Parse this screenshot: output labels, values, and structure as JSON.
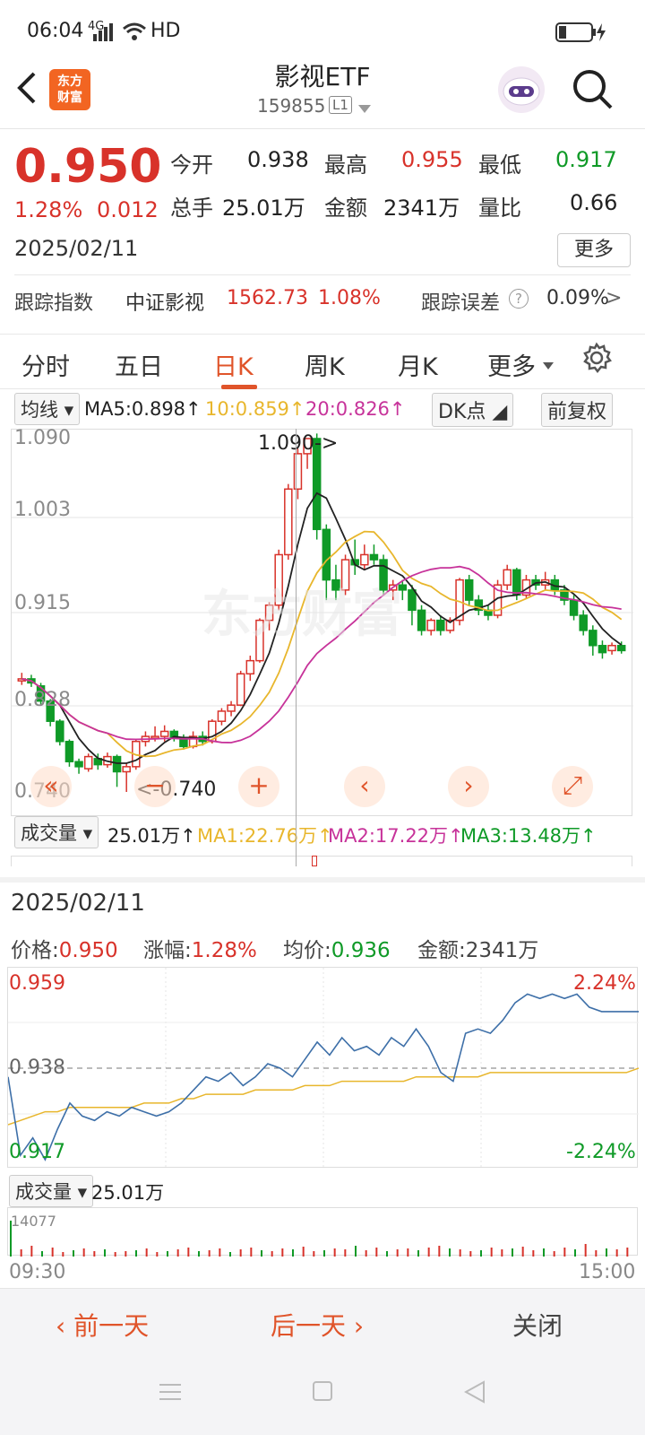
{
  "status": {
    "time": "06:04",
    "signal": "4G",
    "network": "HD"
  },
  "header": {
    "title": "影视ETF",
    "code": "159855",
    "level": "L1",
    "logo_text_1": "东方",
    "logo_text_2": "财富"
  },
  "quote": {
    "price": "0.950",
    "change_pct": "1.28%",
    "change_amt": "0.012",
    "date": "2025/02/11",
    "open_label": "今开",
    "open": "0.938",
    "high_label": "最高",
    "high": "0.955",
    "low_label": "最低",
    "low": "0.917",
    "vol_label": "总手",
    "vol": "25.01万",
    "amount_label": "金额",
    "amount": "2341万",
    "ratio_label": "量比",
    "ratio": "0.66",
    "more": "更多"
  },
  "tracking": {
    "label": "跟踪指数",
    "index": "中证影视",
    "index_value": "1562.73",
    "index_pct": "1.08%",
    "error_label": "跟踪误差",
    "error_value": "0.09%"
  },
  "tabs": [
    "分时",
    "五日",
    "日K",
    "周K",
    "月K",
    "更多"
  ],
  "ma": {
    "selector": "均线",
    "ma5": "MA5:0.898",
    "ma10": "10:0.859",
    "ma20": "20:0.826",
    "dk": "DK点",
    "fq": "前复权"
  },
  "kchart": {
    "y_labels": [
      "1.090",
      "1.003",
      "0.915",
      "0.828",
      "0.740"
    ],
    "max_label": "1.090->",
    "min_label": "<-0.740"
  },
  "volume": {
    "selector": "成交量",
    "vol": "25.01万",
    "ma1": "MA1:22.76万",
    "ma2": "MA2:17.22万",
    "ma3": "MA3:13.48万"
  },
  "detail": {
    "date": "2025/02/11",
    "price_label": "价格:",
    "price": "0.950",
    "pct_label": "涨幅:",
    "pct": "1.28%",
    "avg_label": "均价:",
    "avg": "0.936",
    "amount_label": "金额:",
    "amount": "2341万"
  },
  "timeshare": {
    "top": "0.959",
    "mid": "0.938",
    "bottom": "0.917",
    "top_pct": "2.24%",
    "bottom_pct": "-2.24%",
    "vol_selector": "成交量",
    "vol": "25.01万",
    "vol_max": "14077",
    "time_start": "09:30",
    "time_end": "15:00"
  },
  "footer": {
    "prev": "前一天",
    "next": "后一天",
    "close": "关闭"
  },
  "colors": {
    "up": "#d8322a",
    "down": "#0f9a27",
    "accent": "#e0542a",
    "ma5": "#222222",
    "ma10": "#e8b62c",
    "ma20": "#c7339a"
  }
}
